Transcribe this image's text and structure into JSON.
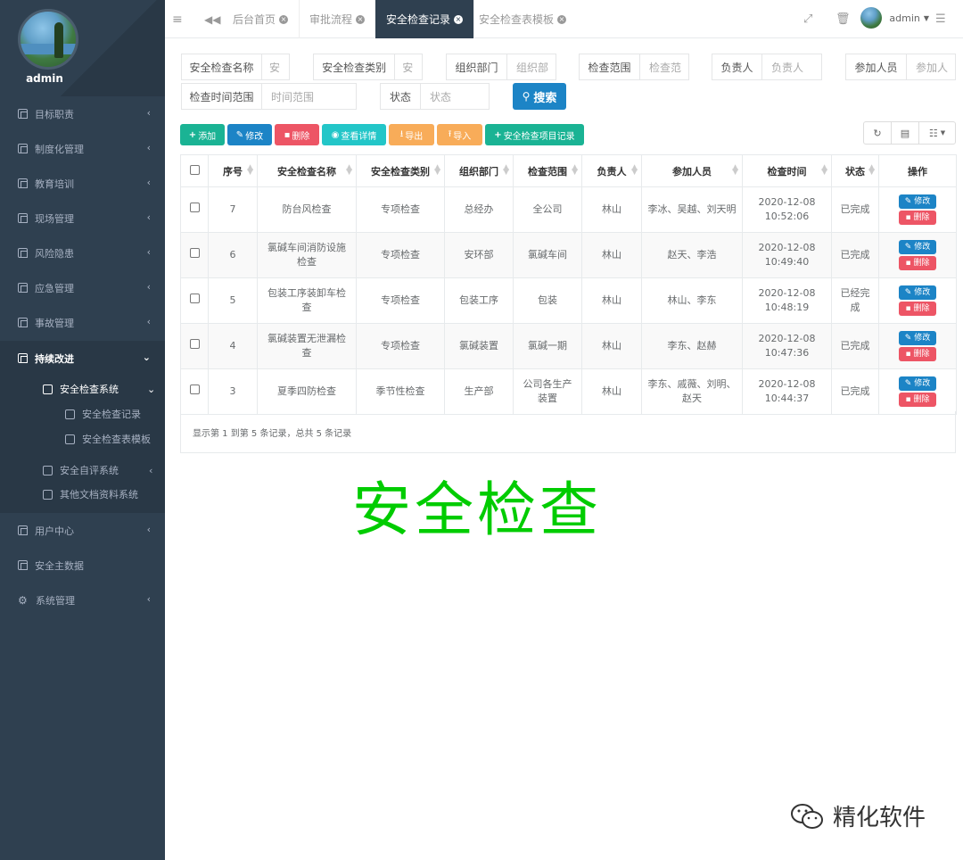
{
  "user": {
    "name": "admin"
  },
  "sidebar": {
    "items": [
      {
        "label": "目标职责"
      },
      {
        "label": "制度化管理"
      },
      {
        "label": "教育培训"
      },
      {
        "label": "现场管理"
      },
      {
        "label": "风险隐患"
      },
      {
        "label": "应急管理"
      },
      {
        "label": "事故管理"
      },
      {
        "label": "持续改进"
      },
      {
        "label": "用户中心"
      },
      {
        "label": "安全主数据"
      },
      {
        "label": "系统管理"
      }
    ],
    "sub": {
      "system": "安全检查系统",
      "record": "安全检查记录",
      "template": "安全检查表模板",
      "selfeval": "安全自评系统",
      "docs": "其他文档资料系统"
    }
  },
  "tabs": [
    {
      "label": "后台首页"
    },
    {
      "label": "审批流程"
    },
    {
      "label": "安全检查记录"
    },
    {
      "label": "安全检查表模板"
    }
  ],
  "filters": {
    "name": {
      "label": "安全检查名称",
      "placeholder": "安"
    },
    "category": {
      "label": "安全检查类别",
      "placeholder": "安"
    },
    "dept": {
      "label": "组织部门",
      "placeholder": "组织部"
    },
    "scope": {
      "label": "检查范围",
      "placeholder": "检查范"
    },
    "owner": {
      "label": "负责人",
      "placeholder": "负责人"
    },
    "participants": {
      "label": "参加人员",
      "placeholder": "参加人"
    },
    "timerange": {
      "label": "检查时间范围",
      "placeholder": "时间范围"
    },
    "status": {
      "label": "状态",
      "placeholder": "状态"
    },
    "search": "搜索"
  },
  "toolbar": {
    "add": "添加",
    "edit": "修改",
    "delete": "删除",
    "detail": "查看详情",
    "export": "导出",
    "import": "导入",
    "item_record": "安全检查项目记录"
  },
  "table": {
    "headers": [
      "序号",
      "安全检查名称",
      "安全检查类别",
      "组织部门",
      "检查范围",
      "负责人",
      "参加人员",
      "检查时间",
      "状态",
      "操作"
    ],
    "rows": [
      {
        "no": "7",
        "name": "防台风检查",
        "category": "专项检查",
        "dept": "总经办",
        "scope": "全公司",
        "owner": "林山",
        "participants": "李冰、吴越、刘天明",
        "date": "2020-12-08",
        "time": "10:52:06",
        "status": "已完成"
      },
      {
        "no": "6",
        "name": "氯碱车间消防设施检查",
        "category": "专项检查",
        "dept": "安环部",
        "scope": "氯碱车间",
        "owner": "林山",
        "participants": "赵天、李浩",
        "date": "2020-12-08",
        "time": "10:49:40",
        "status": "已完成"
      },
      {
        "no": "5",
        "name": "包装工序装卸车检查",
        "category": "专项检查",
        "dept": "包装工序",
        "scope": "包装",
        "owner": "林山",
        "participants": "林山、李东",
        "date": "2020-12-08",
        "time": "10:48:19",
        "status": "已经完成"
      },
      {
        "no": "4",
        "name": "氯碱装置无泄漏检查",
        "category": "专项检查",
        "dept": "氯碱装置",
        "scope": "氯碱一期",
        "owner": "林山",
        "participants": "李东、赵赫",
        "date": "2020-12-08",
        "time": "10:47:36",
        "status": "已完成"
      },
      {
        "no": "3",
        "name": "夏季四防检查",
        "category": "季节性检查",
        "dept": "生产部",
        "scope": "公司各生产装置",
        "owner": "林山",
        "participants": "李东、戚薇、刘明、赵天",
        "date": "2020-12-08",
        "time": "10:44:37",
        "status": "已完成"
      }
    ],
    "op_edit": "修改",
    "op_delete": "删除",
    "footer": "显示第 1 到第 5 条记录，总共 5 条记录"
  },
  "banner": "安全检查",
  "watermark": "精化软件"
}
